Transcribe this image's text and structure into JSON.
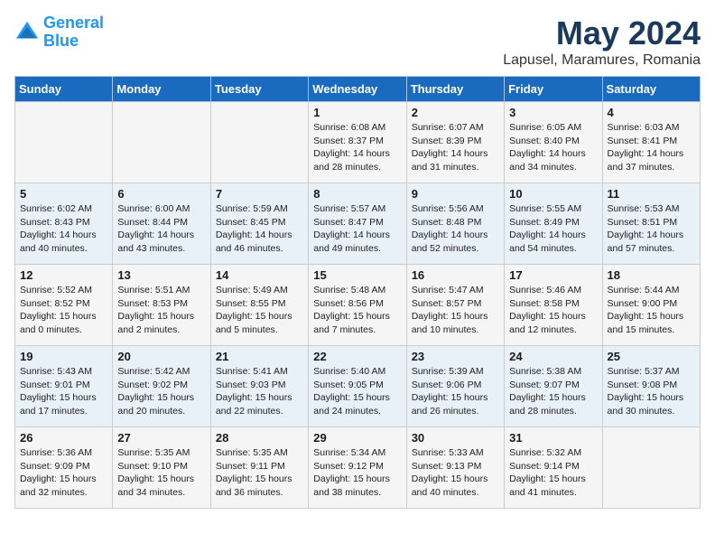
{
  "header": {
    "logo_line1": "General",
    "logo_line2": "Blue",
    "title": "May 2024",
    "subtitle": "Lapusel, Maramures, Romania"
  },
  "days_of_week": [
    "Sunday",
    "Monday",
    "Tuesday",
    "Wednesday",
    "Thursday",
    "Friday",
    "Saturday"
  ],
  "weeks": [
    [
      {
        "day": "",
        "info": ""
      },
      {
        "day": "",
        "info": ""
      },
      {
        "day": "",
        "info": ""
      },
      {
        "day": "1",
        "info": "Sunrise: 6:08 AM\nSunset: 8:37 PM\nDaylight: 14 hours\nand 28 minutes."
      },
      {
        "day": "2",
        "info": "Sunrise: 6:07 AM\nSunset: 8:39 PM\nDaylight: 14 hours\nand 31 minutes."
      },
      {
        "day": "3",
        "info": "Sunrise: 6:05 AM\nSunset: 8:40 PM\nDaylight: 14 hours\nand 34 minutes."
      },
      {
        "day": "4",
        "info": "Sunrise: 6:03 AM\nSunset: 8:41 PM\nDaylight: 14 hours\nand 37 minutes."
      }
    ],
    [
      {
        "day": "5",
        "info": "Sunrise: 6:02 AM\nSunset: 8:43 PM\nDaylight: 14 hours\nand 40 minutes."
      },
      {
        "day": "6",
        "info": "Sunrise: 6:00 AM\nSunset: 8:44 PM\nDaylight: 14 hours\nand 43 minutes."
      },
      {
        "day": "7",
        "info": "Sunrise: 5:59 AM\nSunset: 8:45 PM\nDaylight: 14 hours\nand 46 minutes."
      },
      {
        "day": "8",
        "info": "Sunrise: 5:57 AM\nSunset: 8:47 PM\nDaylight: 14 hours\nand 49 minutes."
      },
      {
        "day": "9",
        "info": "Sunrise: 5:56 AM\nSunset: 8:48 PM\nDaylight: 14 hours\nand 52 minutes."
      },
      {
        "day": "10",
        "info": "Sunrise: 5:55 AM\nSunset: 8:49 PM\nDaylight: 14 hours\nand 54 minutes."
      },
      {
        "day": "11",
        "info": "Sunrise: 5:53 AM\nSunset: 8:51 PM\nDaylight: 14 hours\nand 57 minutes."
      }
    ],
    [
      {
        "day": "12",
        "info": "Sunrise: 5:52 AM\nSunset: 8:52 PM\nDaylight: 15 hours\nand 0 minutes."
      },
      {
        "day": "13",
        "info": "Sunrise: 5:51 AM\nSunset: 8:53 PM\nDaylight: 15 hours\nand 2 minutes."
      },
      {
        "day": "14",
        "info": "Sunrise: 5:49 AM\nSunset: 8:55 PM\nDaylight: 15 hours\nand 5 minutes."
      },
      {
        "day": "15",
        "info": "Sunrise: 5:48 AM\nSunset: 8:56 PM\nDaylight: 15 hours\nand 7 minutes."
      },
      {
        "day": "16",
        "info": "Sunrise: 5:47 AM\nSunset: 8:57 PM\nDaylight: 15 hours\nand 10 minutes."
      },
      {
        "day": "17",
        "info": "Sunrise: 5:46 AM\nSunset: 8:58 PM\nDaylight: 15 hours\nand 12 minutes."
      },
      {
        "day": "18",
        "info": "Sunrise: 5:44 AM\nSunset: 9:00 PM\nDaylight: 15 hours\nand 15 minutes."
      }
    ],
    [
      {
        "day": "19",
        "info": "Sunrise: 5:43 AM\nSunset: 9:01 PM\nDaylight: 15 hours\nand 17 minutes."
      },
      {
        "day": "20",
        "info": "Sunrise: 5:42 AM\nSunset: 9:02 PM\nDaylight: 15 hours\nand 20 minutes."
      },
      {
        "day": "21",
        "info": "Sunrise: 5:41 AM\nSunset: 9:03 PM\nDaylight: 15 hours\nand 22 minutes."
      },
      {
        "day": "22",
        "info": "Sunrise: 5:40 AM\nSunset: 9:05 PM\nDaylight: 15 hours\nand 24 minutes."
      },
      {
        "day": "23",
        "info": "Sunrise: 5:39 AM\nSunset: 9:06 PM\nDaylight: 15 hours\nand 26 minutes."
      },
      {
        "day": "24",
        "info": "Sunrise: 5:38 AM\nSunset: 9:07 PM\nDaylight: 15 hours\nand 28 minutes."
      },
      {
        "day": "25",
        "info": "Sunrise: 5:37 AM\nSunset: 9:08 PM\nDaylight: 15 hours\nand 30 minutes."
      }
    ],
    [
      {
        "day": "26",
        "info": "Sunrise: 5:36 AM\nSunset: 9:09 PM\nDaylight: 15 hours\nand 32 minutes."
      },
      {
        "day": "27",
        "info": "Sunrise: 5:35 AM\nSunset: 9:10 PM\nDaylight: 15 hours\nand 34 minutes."
      },
      {
        "day": "28",
        "info": "Sunrise: 5:35 AM\nSunset: 9:11 PM\nDaylight: 15 hours\nand 36 minutes."
      },
      {
        "day": "29",
        "info": "Sunrise: 5:34 AM\nSunset: 9:12 PM\nDaylight: 15 hours\nand 38 minutes."
      },
      {
        "day": "30",
        "info": "Sunrise: 5:33 AM\nSunset: 9:13 PM\nDaylight: 15 hours\nand 40 minutes."
      },
      {
        "day": "31",
        "info": "Sunrise: 5:32 AM\nSunset: 9:14 PM\nDaylight: 15 hours\nand 41 minutes."
      },
      {
        "day": "",
        "info": ""
      }
    ]
  ]
}
